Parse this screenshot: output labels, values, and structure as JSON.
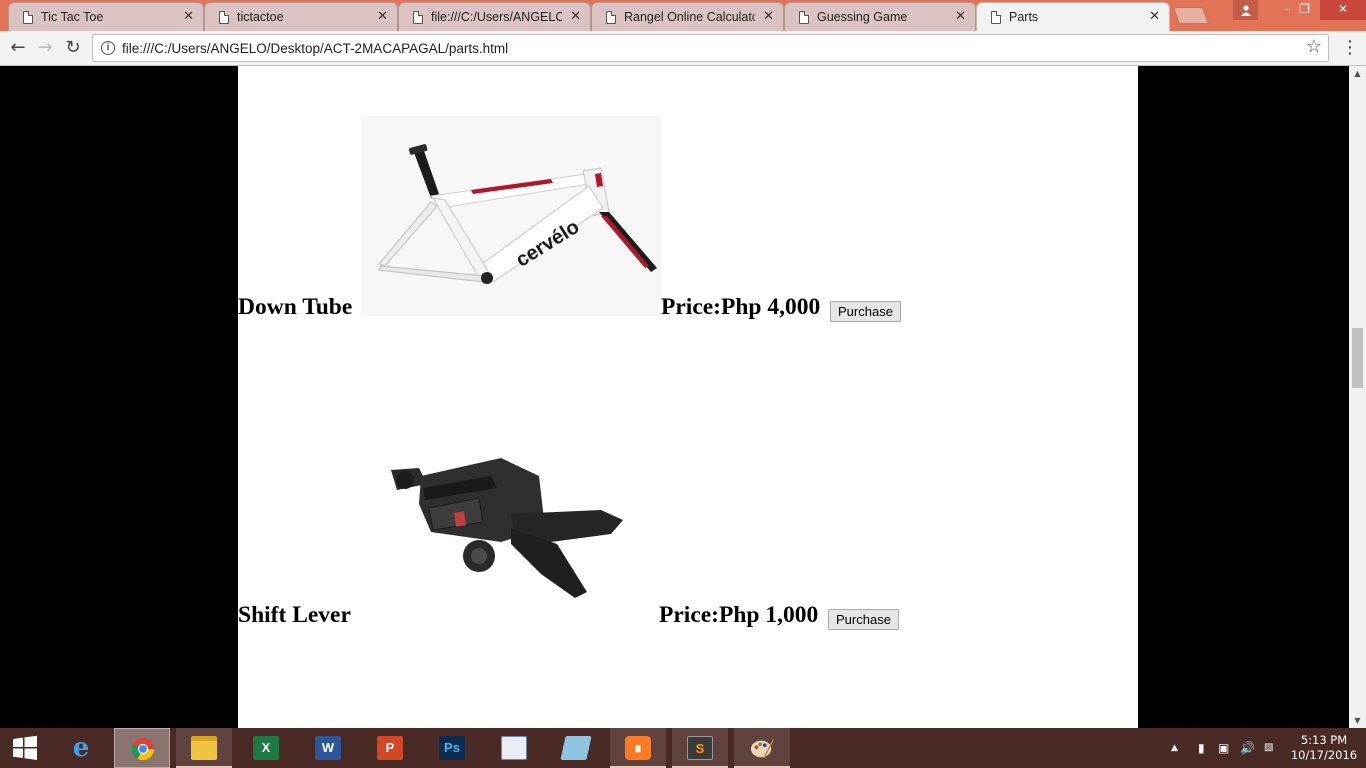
{
  "browser": {
    "tabs": [
      {
        "title": "Tic Tac Toe",
        "active": false
      },
      {
        "title": "tictactoe",
        "active": false
      },
      {
        "title": "file:///C:/Users/ANGELO/",
        "active": false
      },
      {
        "title": "Rangel Online Calculator",
        "active": false
      },
      {
        "title": "Guessing Game",
        "active": false
      },
      {
        "title": "Parts",
        "active": true
      }
    ],
    "url": "file:///C:/Users/ANGELO/Desktop/ACT-2MACAPAGAL/parts.html",
    "close_glyph": "✕"
  },
  "page": {
    "parts": [
      {
        "name": "Down Tube",
        "price": "Price:Php 4,000",
        "button": "Purchase",
        "image": "white-road-bike-frame"
      },
      {
        "name": "Shift Lever",
        "price": "Price:Php 1,000",
        "button": "Purchase",
        "image": "black-shift-lever"
      }
    ]
  },
  "taskbar": {
    "apps": [
      {
        "name": "Internet Explorer",
        "icon": "internet-explorer-icon",
        "state": "pinned"
      },
      {
        "name": "Google Chrome",
        "icon": "chrome-icon",
        "state": "active"
      },
      {
        "name": "File Explorer",
        "icon": "file-explorer-icon",
        "state": "open"
      },
      {
        "name": "Excel",
        "icon": "excel-icon",
        "state": "pinned"
      },
      {
        "name": "Word",
        "icon": "word-icon",
        "state": "pinned"
      },
      {
        "name": "PowerPoint",
        "icon": "powerpoint-icon",
        "state": "pinned"
      },
      {
        "name": "Photoshop",
        "icon": "photoshop-icon",
        "state": "pinned"
      },
      {
        "name": "MySQL Installer",
        "icon": "mysql-icon",
        "state": "pinned"
      },
      {
        "name": "Notepad",
        "icon": "notepad-icon",
        "state": "pinned"
      },
      {
        "name": "XAMPP",
        "icon": "xampp-icon",
        "state": "open"
      },
      {
        "name": "Sublime Text",
        "icon": "sublime-icon",
        "state": "open"
      },
      {
        "name": "Paint",
        "icon": "paint-icon",
        "state": "open"
      }
    ],
    "clock": {
      "time": "5:13 PM",
      "date": "10/17/2016"
    }
  },
  "colors": {
    "tabstrip": "#e37356",
    "page_background": "#000000",
    "content_background": "#ffffff",
    "taskbar": "#4a2a24"
  }
}
